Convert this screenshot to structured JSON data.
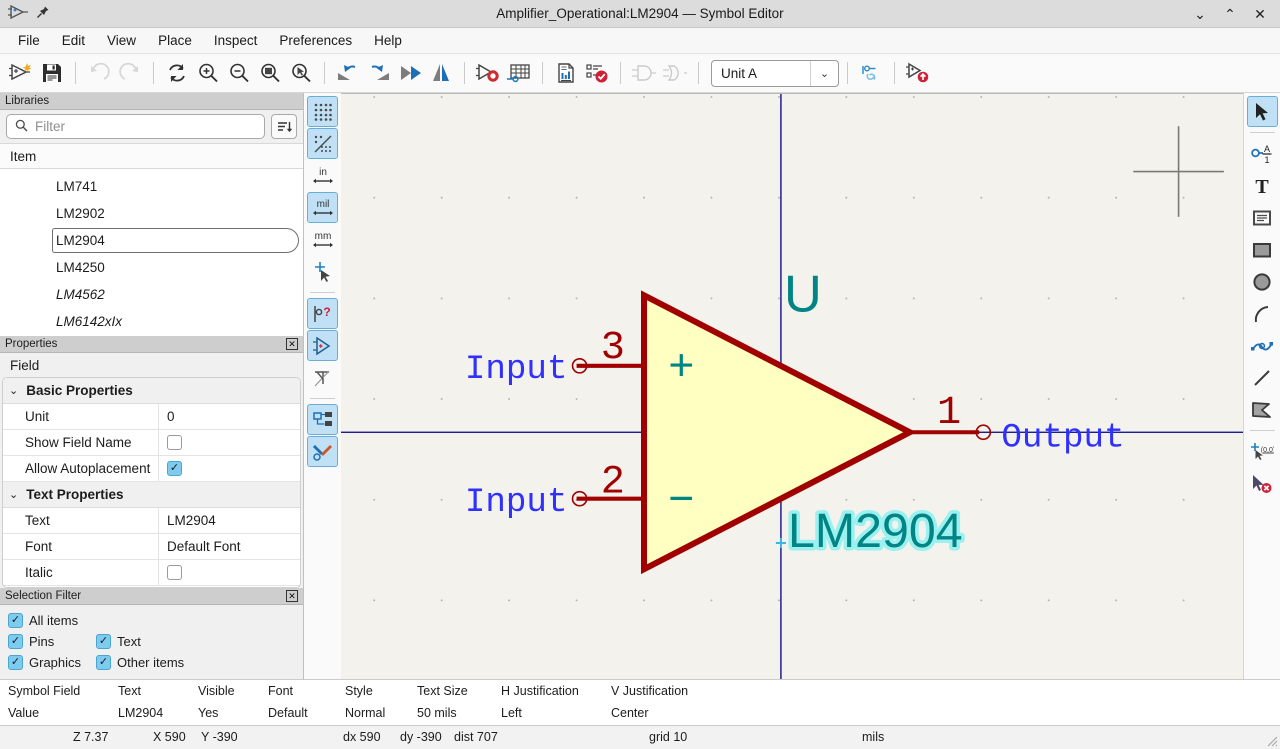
{
  "window": {
    "title": "Amplifier_Operational:LM2904 — Symbol Editor",
    "app_icon": "kicad-symbol-editor-icon",
    "pin_icon": "pin-icon",
    "minimize": "⌄",
    "maximize": "⌃",
    "close": "✕"
  },
  "menubar": {
    "items": [
      {
        "label": "File"
      },
      {
        "label": "Edit"
      },
      {
        "label": "View"
      },
      {
        "label": "Place"
      },
      {
        "label": "Inspect"
      },
      {
        "label": "Preferences"
      },
      {
        "label": "Help"
      }
    ]
  },
  "toolbar": {
    "unit_value": "Unit A",
    "unit_arrow": "⌄",
    "buttons": [
      {
        "name": "new-symbol-button",
        "tip": "New symbol"
      },
      {
        "name": "save-button",
        "tip": "Save"
      },
      {
        "name": "undo-button",
        "tip": "Undo"
      },
      {
        "name": "redo-button",
        "tip": "Redo"
      },
      {
        "name": "refresh-button",
        "tip": "Refresh"
      },
      {
        "name": "zoom-in-button",
        "tip": "Zoom in"
      },
      {
        "name": "zoom-out-button",
        "tip": "Zoom out"
      },
      {
        "name": "zoom-fit-button",
        "tip": "Zoom to fit"
      },
      {
        "name": "zoom-selection-button",
        "tip": "Zoom to selection"
      },
      {
        "name": "rotate-ccw-button",
        "tip": "Rotate counterclockwise"
      },
      {
        "name": "rotate-cw-button",
        "tip": "Rotate clockwise"
      },
      {
        "name": "mirror-horizontal-button",
        "tip": "Mirror horizontally"
      },
      {
        "name": "mirror-vertical-button",
        "tip": "Mirror vertically"
      },
      {
        "name": "symbol-properties-button",
        "tip": "Symbol properties"
      },
      {
        "name": "pin-table-button",
        "tip": "Pin table"
      },
      {
        "name": "datasheet-button",
        "tip": "Datasheet"
      },
      {
        "name": "check-symbol-button",
        "tip": "Check symbol"
      },
      {
        "name": "demorgan-standard-button",
        "tip": "Standard body style"
      },
      {
        "name": "demorgan-alternate-button",
        "tip": "Alternate body style"
      },
      {
        "name": "sync-pins-button",
        "tip": "Synchronized pins edit mode"
      },
      {
        "name": "export-symbol-button",
        "tip": "Export symbol"
      }
    ]
  },
  "libraries": {
    "panel_title": "Libraries",
    "filter_placeholder": "Filter",
    "search_icon": "search-icon",
    "sort_icon": "sort-icon",
    "column_header": "Item",
    "items": [
      {
        "label": "LM741",
        "italic": false,
        "selected": false
      },
      {
        "label": "LM2902",
        "italic": false,
        "selected": false
      },
      {
        "label": "LM2904",
        "italic": false,
        "selected": true
      },
      {
        "label": "LM4250",
        "italic": false,
        "selected": false
      },
      {
        "label": "LM4562",
        "italic": true,
        "selected": false
      },
      {
        "label": "LM6142xIx",
        "italic": true,
        "selected": false
      }
    ]
  },
  "properties": {
    "panel_title": "Properties",
    "close_icon": "close-icon",
    "object_label": "Field",
    "groups": [
      {
        "title": "Basic Properties",
        "chevron": "⌄",
        "rows": [
          {
            "key": "Unit",
            "value": "0",
            "type": "text"
          },
          {
            "key": "Show Field Name",
            "value": "",
            "type": "checkbox",
            "checked": false
          },
          {
            "key": "Allow Autoplacement",
            "value": "",
            "type": "checkbox",
            "checked": true
          }
        ]
      },
      {
        "title": "Text Properties",
        "chevron": "⌄",
        "rows": [
          {
            "key": "Text",
            "value": "LM2904",
            "type": "text"
          },
          {
            "key": "Font",
            "value": "Default Font",
            "type": "text"
          },
          {
            "key": "Italic",
            "value": "",
            "type": "checkbox",
            "checked": false
          }
        ]
      }
    ]
  },
  "selection_filter": {
    "panel_title": "Selection Filter",
    "close_icon": "close-icon",
    "options": [
      {
        "label": "All items",
        "checked": true
      },
      {
        "label": "Pins",
        "checked": true
      },
      {
        "label": "Text",
        "checked": true
      },
      {
        "label": "Graphics",
        "checked": true
      },
      {
        "label": "Other items",
        "checked": true
      }
    ]
  },
  "left_canvas_toolbar": {
    "buttons": [
      {
        "name": "toggle-grid-button",
        "icon": "grid-dots-icon",
        "active": true
      },
      {
        "name": "grid-overrides-button",
        "icon": "grid-overrides-icon",
        "active": true
      },
      {
        "name": "units-inches-button",
        "icon": "in-icon",
        "label": "in",
        "active": false
      },
      {
        "name": "units-mils-button",
        "icon": "mil-icon",
        "label": "mil",
        "active": true
      },
      {
        "name": "units-millimeters-button",
        "icon": "mm-icon",
        "label": "mm",
        "active": false
      },
      {
        "name": "toggle-cursor-button",
        "icon": "full-crosshair-icon",
        "active": false
      },
      {
        "name": "show-pin-electrical-types-button",
        "icon": "pin-type-icon",
        "active": true
      },
      {
        "name": "show-symbol-tree-button",
        "icon": "symbol-pin-icon",
        "active": true
      },
      {
        "name": "show-hidden-pins-button",
        "icon": "hidden-pin-icon",
        "active": false
      },
      {
        "name": "show-libraries-panel-button",
        "icon": "tree-panel-icon",
        "active": true
      },
      {
        "name": "show-properties-panel-button",
        "icon": "tools-icon",
        "active": true
      }
    ]
  },
  "right_canvas_toolbar": {
    "buttons": [
      {
        "name": "select-tool-button",
        "icon": "cursor-arrow-icon",
        "active": true
      },
      {
        "name": "add-pin-tool-button",
        "icon": "pin-icon",
        "active": false
      },
      {
        "name": "add-text-tool-button",
        "icon": "text-T-icon",
        "active": false
      },
      {
        "name": "add-textbox-tool-button",
        "icon": "textbox-icon",
        "active": false
      },
      {
        "name": "add-rectangle-tool-button",
        "icon": "rectangle-icon",
        "active": false
      },
      {
        "name": "add-circle-tool-button",
        "icon": "circle-icon",
        "active": false
      },
      {
        "name": "add-arc-tool-button",
        "icon": "arc-icon",
        "active": false
      },
      {
        "name": "add-bezier-tool-button",
        "icon": "bezier-icon",
        "active": false
      },
      {
        "name": "add-line-tool-button",
        "icon": "line-icon",
        "active": false
      },
      {
        "name": "add-polygon-tool-button",
        "icon": "polygon-icon",
        "active": false
      },
      {
        "name": "set-anchor-tool-button",
        "icon": "anchor-origin-icon",
        "active": false
      },
      {
        "name": "delete-tool-button",
        "icon": "delete-cursor-icon",
        "active": false
      }
    ]
  },
  "canvas": {
    "symbol_reference": "U",
    "symbol_value": "LM2904",
    "value_selected": true,
    "pins": [
      {
        "number": "3",
        "name": "Input",
        "polarity": "+",
        "position": "top-left"
      },
      {
        "number": "2",
        "name": "Input",
        "polarity": "−",
        "position": "bottom-left"
      },
      {
        "number": "1",
        "name": "Output",
        "polarity": "",
        "position": "right"
      }
    ],
    "colors": {
      "background": "#f3f2ed",
      "body_fill": "#ffffc2",
      "body_outline": "#a00000",
      "pin_line": "#a00000",
      "pin_number": "#a00000",
      "pin_name": "#3030ff",
      "field_text": "#008484",
      "axis": "#000080",
      "selection_glow": "#9bf0f0",
      "grid_dot": "#b6b5ac"
    }
  },
  "field_info": {
    "headers": [
      "Symbol Field",
      "Text",
      "Visible",
      "Font",
      "Style",
      "Text Size",
      "H Justification",
      "V Justification"
    ],
    "row": [
      "Value",
      "LM2904",
      "Yes",
      "Default",
      "Normal",
      "50 mils",
      "Left",
      "Center"
    ]
  },
  "statusbar": {
    "zoom": "Z 7.37",
    "x": "X 590",
    "y": "Y -390",
    "dx": "dx 590",
    "dy": "dy -390",
    "dist": "dist 707",
    "grid": "grid 10",
    "units": "mils"
  }
}
